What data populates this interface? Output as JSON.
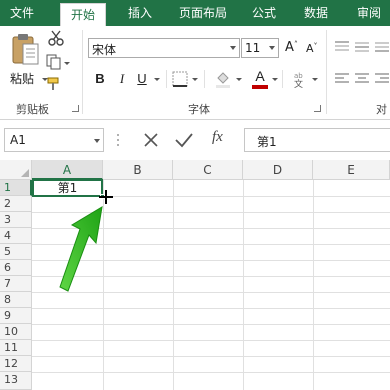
{
  "ribbon": {
    "tabs": [
      {
        "label": "文件",
        "active": false
      },
      {
        "label": "开始",
        "active": true
      },
      {
        "label": "插入",
        "active": false
      },
      {
        "label": "页面布局",
        "active": false
      },
      {
        "label": "公式",
        "active": false
      },
      {
        "label": "数据",
        "active": false
      },
      {
        "label": "审阅",
        "active": false
      }
    ],
    "clipboard": {
      "paste_label": "粘贴",
      "group_label": "剪贴板"
    },
    "font": {
      "font_name": "宋体",
      "font_size": "11",
      "group_label": "字体",
      "bold": "B",
      "italic": "I",
      "underline": "U",
      "font_color": "A",
      "grow": "A",
      "shrink": "A"
    },
    "alignment": {
      "group_label_partial": "对"
    }
  },
  "formula_bar": {
    "name_box": "A1",
    "fx": "fx",
    "content": "第1"
  },
  "sheet": {
    "columns": [
      "A",
      "B",
      "C",
      "D",
      "E"
    ],
    "rows": [
      "1",
      "2",
      "3",
      "4",
      "5",
      "6",
      "7",
      "8",
      "9",
      "10",
      "11",
      "12",
      "13"
    ],
    "selected_cell": "A1",
    "cell_a1": "第1"
  },
  "colors": {
    "accent": "#217346",
    "arrow": "#3dbd2a"
  }
}
